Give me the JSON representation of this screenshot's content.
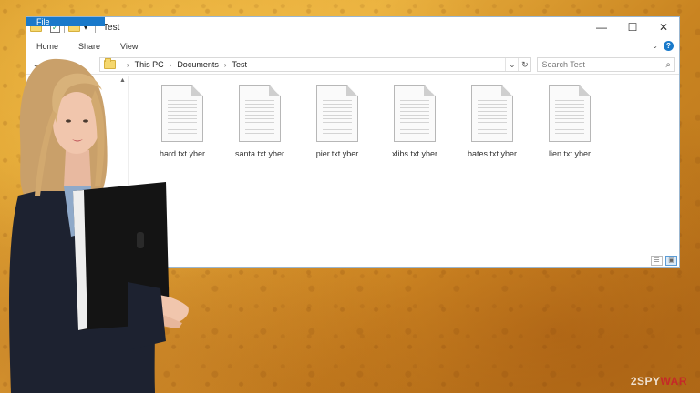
{
  "window": {
    "title": "Test",
    "controls": {
      "minimize": "—",
      "maximize": "☐",
      "close": "✕"
    }
  },
  "ribbon": {
    "tabs": [
      "File",
      "Home",
      "Share",
      "View"
    ]
  },
  "address": {
    "crumbs": [
      "This PC",
      "Documents",
      "Test"
    ],
    "search_placeholder": "Search Test"
  },
  "files": [
    {
      "name": "hard.txt.yber"
    },
    {
      "name": "santa.txt.yber"
    },
    {
      "name": "pier.txt.yber"
    },
    {
      "name": "xlibs.txt.yber"
    },
    {
      "name": "bates.txt.yber"
    },
    {
      "name": "lien.txt.yber"
    }
  ],
  "watermark": {
    "prefix": "2SPY",
    "suffix": "WAR"
  },
  "colors": {
    "accent": "#1979ca",
    "background": "#e0a235",
    "watermark_red": "#c62828"
  }
}
